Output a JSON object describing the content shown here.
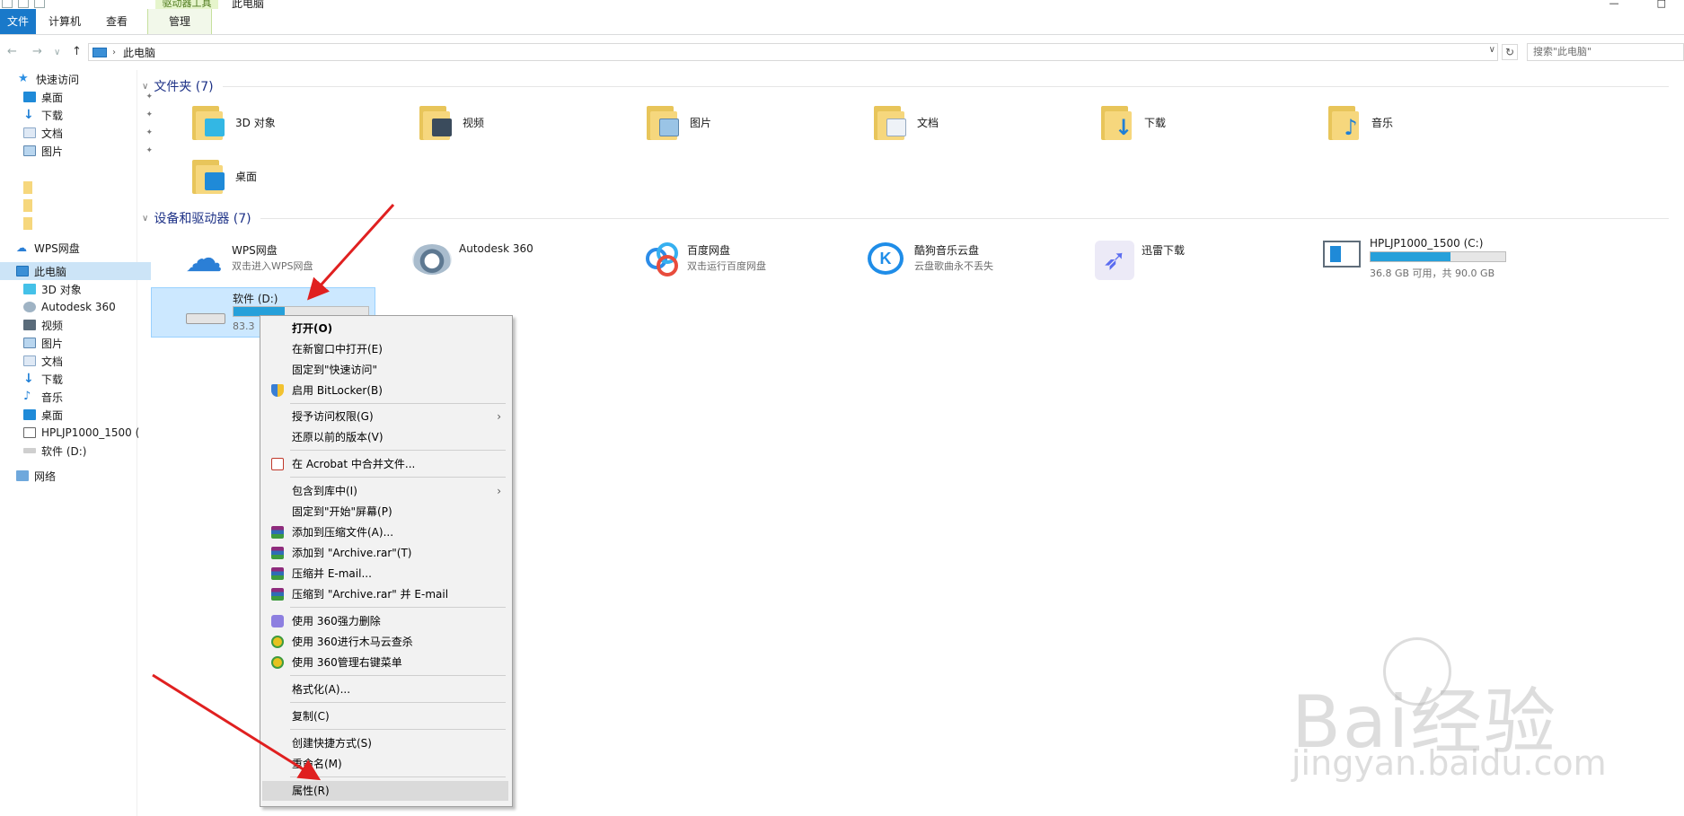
{
  "window": {
    "title": "此电脑",
    "context_group": "驱动器工具",
    "controls": [
      "—",
      "□"
    ]
  },
  "ribbon": {
    "tabs": [
      "文件",
      "计算机",
      "查看",
      "管理"
    ]
  },
  "address": {
    "path": "此电脑",
    "search_placeholder": "搜索\"此电脑\"",
    "back": "←",
    "forward": "→",
    "up": "↑",
    "dropdown": "∨",
    "refresh": "↻"
  },
  "sidebar": {
    "quick_access": "快速访问",
    "quick_items": [
      "桌面",
      "下载",
      "文档",
      "图片"
    ],
    "wps": "WPS网盘",
    "this_pc": "此电脑",
    "pc_items": [
      "3D 对象",
      "Autodesk 360",
      "视频",
      "图片",
      "文档",
      "下载",
      "音乐",
      "桌面",
      "HPLJP1000_1500 (",
      "软件 (D:)"
    ],
    "network": "网络",
    "pin": "📌"
  },
  "folders": {
    "header": "文件夹 (7)",
    "items": [
      "3D 对象",
      "视频",
      "图片",
      "文档",
      "下载",
      "音乐",
      "桌面"
    ]
  },
  "devices": {
    "header": "设备和驱动器 (7)",
    "items": [
      {
        "name": "WPS网盘",
        "sub": "双击进入WPS网盘"
      },
      {
        "name": "Autodesk 360",
        "sub": ""
      },
      {
        "name": "百度网盘",
        "sub": "双击运行百度网盘"
      },
      {
        "name": "酷狗音乐云盘",
        "sub": "云盘歌曲永不丢失"
      },
      {
        "name": "迅雷下载",
        "sub": ""
      },
      {
        "name": "HPLJP1000_1500 (C:)",
        "sub": "36.8 GB 可用，共 90.0 GB",
        "used_fraction": 0.59
      },
      {
        "name": "软件 (D:)",
        "sub": "83.3",
        "used_fraction": 0.38
      }
    ]
  },
  "context_menu": {
    "items": [
      "打开(O)",
      "在新窗口中打开(E)",
      "固定到\"快速访问\"",
      "启用 BitLocker(B)",
      "授予访问权限(G)",
      "还原以前的版本(V)",
      "在 Acrobat 中合并文件...",
      "包含到库中(I)",
      "固定到\"开始\"屏幕(P)",
      "添加到压缩文件(A)...",
      "添加到 \"Archive.rar\"(T)",
      "压缩并 E-mail...",
      "压缩到 \"Archive.rar\" 并 E-mail",
      "使用 360强力删除",
      "使用 360进行木马云查杀",
      "使用 360管理右键菜单",
      "格式化(A)...",
      "复制(C)",
      "创建快捷方式(S)",
      "重命名(M)",
      "属性(R)"
    ],
    "submenu_arrow": "›"
  },
  "watermark": {
    "brand": "Bai经验",
    "url": "jingyan.baidu.com"
  },
  "colors": {
    "accent": "#1979ca",
    "selection": "#cce4f7",
    "drive_bar": "#26a0da",
    "arrow": "#e02020"
  }
}
